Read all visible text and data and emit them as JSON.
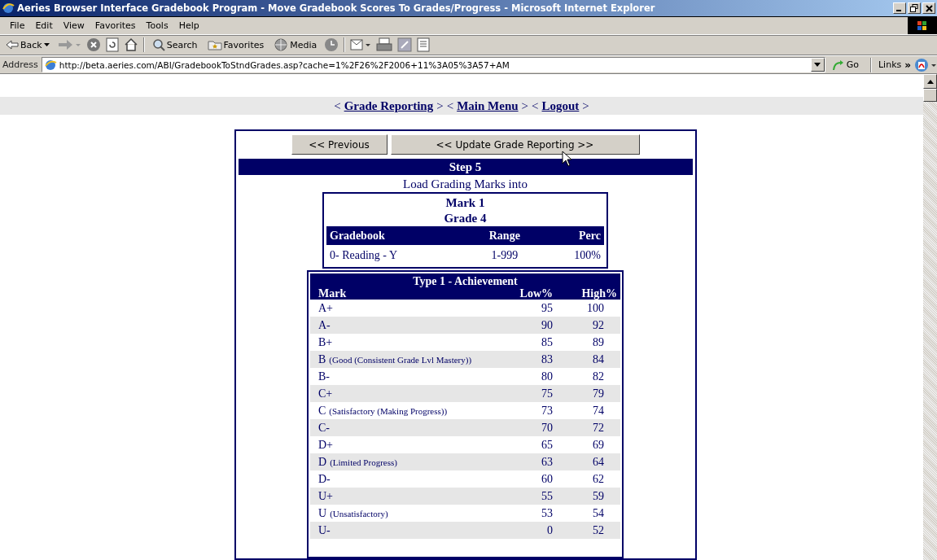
{
  "window": {
    "title": "Aeries Browser Interface Gradebook Program - Move Gradebook Scores To Grades/Progress - Microsoft Internet Explorer"
  },
  "menu": [
    "File",
    "Edit",
    "View",
    "Favorites",
    "Tools",
    "Help"
  ],
  "toolbar": {
    "back": "Back",
    "search": "Search",
    "favorites": "Favorites",
    "media": "Media"
  },
  "address": {
    "label": "Address",
    "url": "http://beta.aeries.com/ABI/GradebookToStndGrades.asp?cache=1%2F26%2F2006+11%3A05%3A57+AM",
    "go": "Go",
    "links": "Links",
    "more": "»"
  },
  "nav": [
    {
      "open": "<",
      "label": "Grade Reporting",
      "close": ">"
    },
    {
      "open": "<",
      "label": "Main Menu",
      "close": ">"
    },
    {
      "open": "<",
      "label": "Logout",
      "close": ">"
    }
  ],
  "buttons": [
    "<< Previous",
    "<< Update Grade Reporting >>"
  ],
  "step": "Step 5",
  "intro": "Load Grading Marks into",
  "mark_box": {
    "mark": "Mark 1",
    "grade": "Grade 4",
    "columns": [
      "Gradebook",
      "Range",
      "Perc"
    ],
    "rows": [
      [
        "0- Reading - Y",
        "1-999",
        "100%"
      ]
    ]
  },
  "marks_table": {
    "title": "Type 1 - Achievement",
    "columns": [
      "Mark",
      "Low%",
      "High%"
    ],
    "rows": [
      {
        "mark": "A+",
        "low": "95",
        "high": "100"
      },
      {
        "mark": "A-",
        "low": "90",
        "high": "92"
      },
      {
        "mark": "B+",
        "low": "85",
        "high": "89"
      },
      {
        "mark": "B",
        "note": "(Good (Consistent Grade Lvl Mastery))",
        "low": "83",
        "high": "84"
      },
      {
        "mark": "B-",
        "low": "80",
        "high": "82"
      },
      {
        "mark": "C+",
        "low": "75",
        "high": "79"
      },
      {
        "mark": "C",
        "note": "(Satisfactory (Making Progress))",
        "low": "73",
        "high": "74"
      },
      {
        "mark": "C-",
        "low": "70",
        "high": "72"
      },
      {
        "mark": "D+",
        "low": "65",
        "high": "69"
      },
      {
        "mark": "D",
        "note": "(Limited Progress)",
        "low": "63",
        "high": "64"
      },
      {
        "mark": "D-",
        "low": "60",
        "high": "62"
      },
      {
        "mark": "U+",
        "low": "55",
        "high": "59"
      },
      {
        "mark": "U",
        "note": "(Unsatisfactory)",
        "low": "53",
        "high": "54"
      },
      {
        "mark": "U-",
        "low": "0",
        "high": "52"
      }
    ]
  }
}
